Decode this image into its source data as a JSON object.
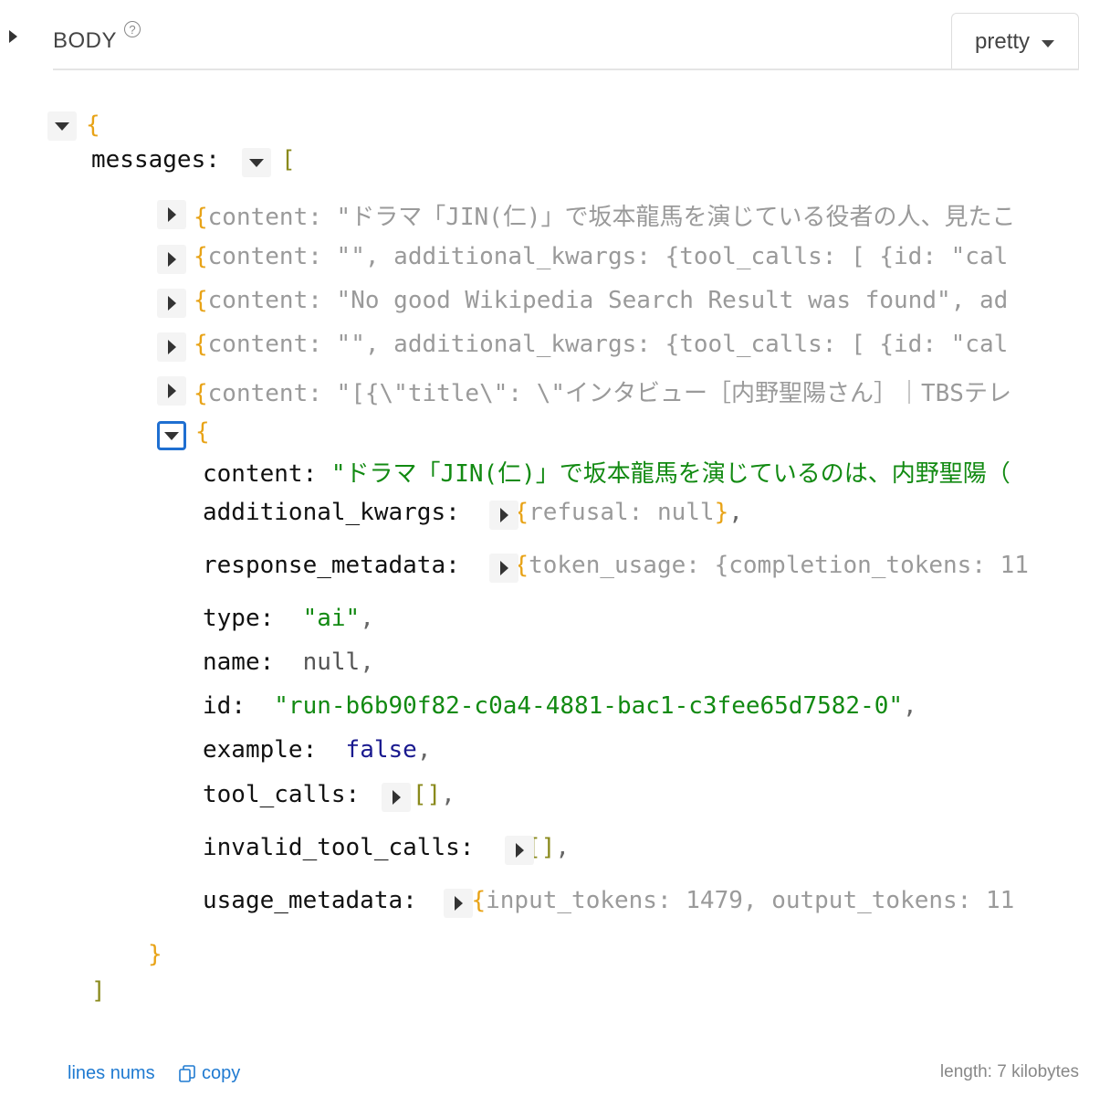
{
  "header": {
    "title": "BODY",
    "help": "?",
    "format": "pretty"
  },
  "tree": {
    "root_open": "{",
    "messages_key": "messages",
    "array_open": "[",
    "collapsed_items": [
      {
        "prefix": "{",
        "key": "content",
        "value": "\"ドラマ「JIN(仁)」で坂本龍馬を演じている役者の人、見たこ"
      },
      {
        "prefix": "{",
        "key": "content",
        "value": "\"\", additional_kwargs: {tool_calls: [ {id:  \"cal"
      },
      {
        "prefix": "{",
        "key": "content",
        "value": "\"No good Wikipedia Search Result was found\", ad"
      },
      {
        "prefix": "{",
        "key": "content",
        "value": "\"\", additional_kwargs: {tool_calls: [ {id:  \"cal"
      },
      {
        "prefix": "{",
        "key": "content",
        "value": "\"[{\\\"title\\\": \\\"インタビュー［内野聖陽さん］｜TBSテレ"
      }
    ],
    "expanded_open": "{",
    "expanded": {
      "content_key": "content",
      "content_value": "\"ドラマ「JIN(仁)」で坂本龍馬を演じているのは、内野聖陽（",
      "additional_kwargs_key": "additional_kwargs",
      "additional_kwargs_preview": "refusal:  null",
      "response_metadata_key": "response_metadata",
      "response_metadata_preview": "token_usage: {completion_tokens:  11",
      "type_key": "type",
      "type_value": "\"ai\"",
      "name_key": "name",
      "name_value": "null",
      "id_key": "id",
      "id_value": "\"run-b6b90f82-c0a4-4881-bac1-c3fee65d7582-0\"",
      "example_key": "example",
      "example_value": "false",
      "tool_calls_key": "tool_calls",
      "tool_calls_value": "[]",
      "invalid_tool_calls_key": "invalid_tool_calls",
      "invalid_tool_calls_value": "[]",
      "usage_metadata_key": "usage_metadata",
      "usage_metadata_preview": "input_tokens:  1479, output_tokens:  11"
    },
    "expanded_close": "}",
    "array_close": "]"
  },
  "footer": {
    "line_nums": "lines nums",
    "copy": "copy",
    "length": "length: 7 kilobytes"
  }
}
